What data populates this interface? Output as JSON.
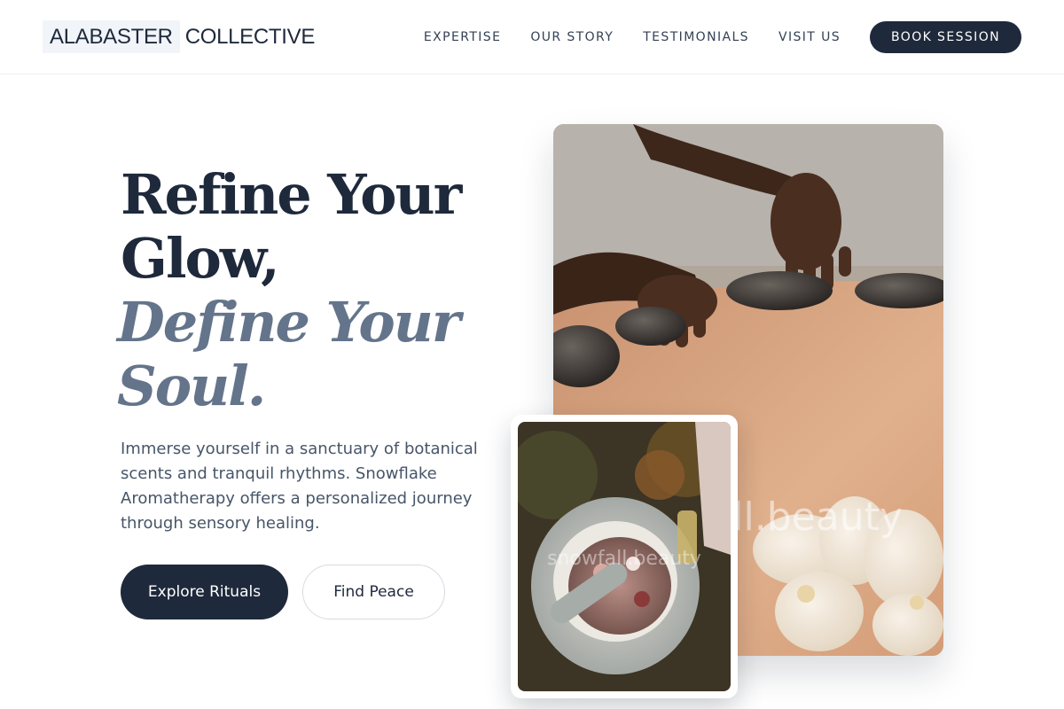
{
  "header": {
    "logo_part1": "ALABASTER",
    "logo_part2": "COLLECTIVE",
    "nav": [
      "EXPERTISE",
      "OUR STORY",
      "TESTIMONIALS",
      "VISIT US"
    ],
    "cta": "BOOK SESSION"
  },
  "hero": {
    "title_line1": "Refine Your",
    "title_line2": "Glow,",
    "title_line3": "Define Your",
    "title_line4": "Soul.",
    "description": "Immerse yourself in a sanctuary of botanical scents and tranquil rhythms. Snowflake Aromatherapy offers a personalized journey through sensory healing.",
    "primary_button": "Explore Rituals",
    "secondary_button": "Find Peace"
  },
  "images": {
    "main_watermark": "snowfall.beauty",
    "inset_watermark": "snowfall.beauty"
  },
  "colors": {
    "primary": "#1e293b",
    "accent_italic": "#64748b",
    "body_text": "#475569"
  }
}
